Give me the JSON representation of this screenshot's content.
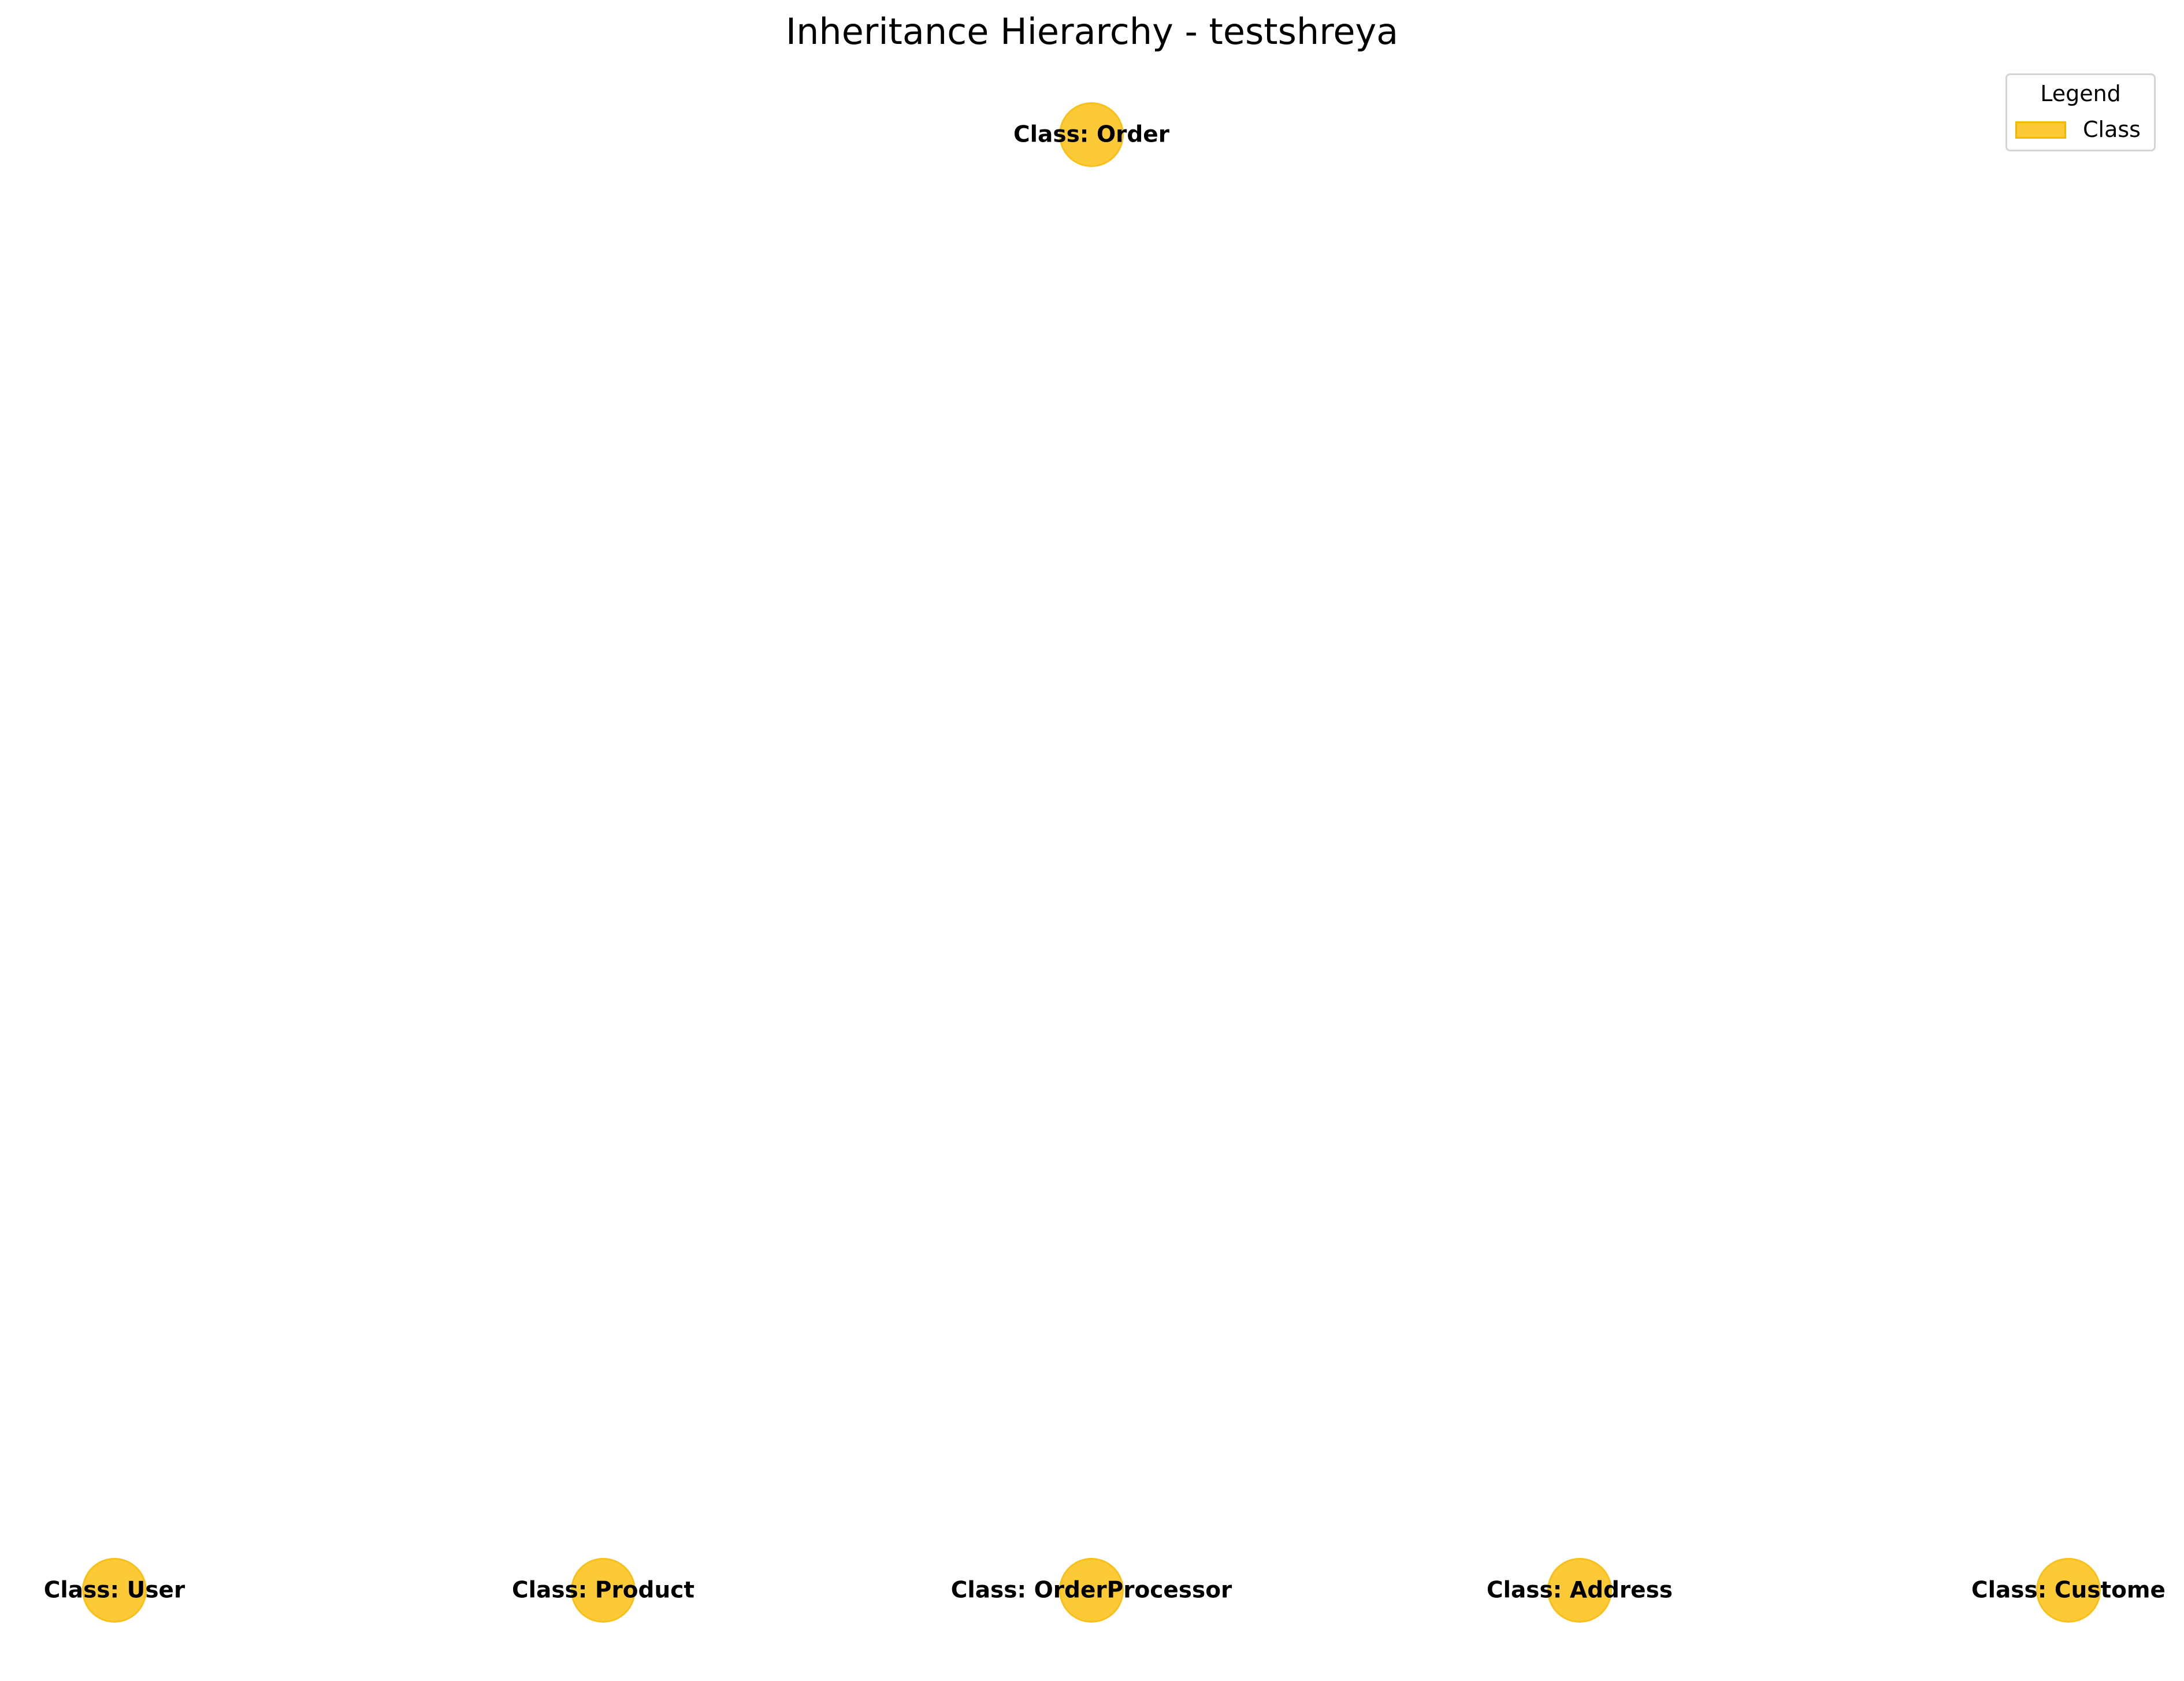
{
  "title": "Inheritance Hierarchy - testshreya",
  "colors": {
    "class_fill": "#FCCA36",
    "class_edge": "#F5B800"
  },
  "legend": {
    "title": "Legend",
    "items": [
      {
        "label": "Class",
        "kind": "class"
      }
    ]
  },
  "nodes": [
    {
      "id": "order",
      "label": "Class: Order",
      "kind": "class",
      "level": 0
    },
    {
      "id": "user",
      "label": "Class: User",
      "kind": "class",
      "level": 1
    },
    {
      "id": "product",
      "label": "Class: Product",
      "kind": "class",
      "level": 1
    },
    {
      "id": "orderprocessor",
      "label": "Class: OrderProcessor",
      "kind": "class",
      "level": 1
    },
    {
      "id": "address",
      "label": "Class: Address",
      "kind": "class",
      "level": 1
    },
    {
      "id": "customer",
      "label": "Class: Custome",
      "kind": "class",
      "level": 1
    }
  ],
  "edges": []
}
